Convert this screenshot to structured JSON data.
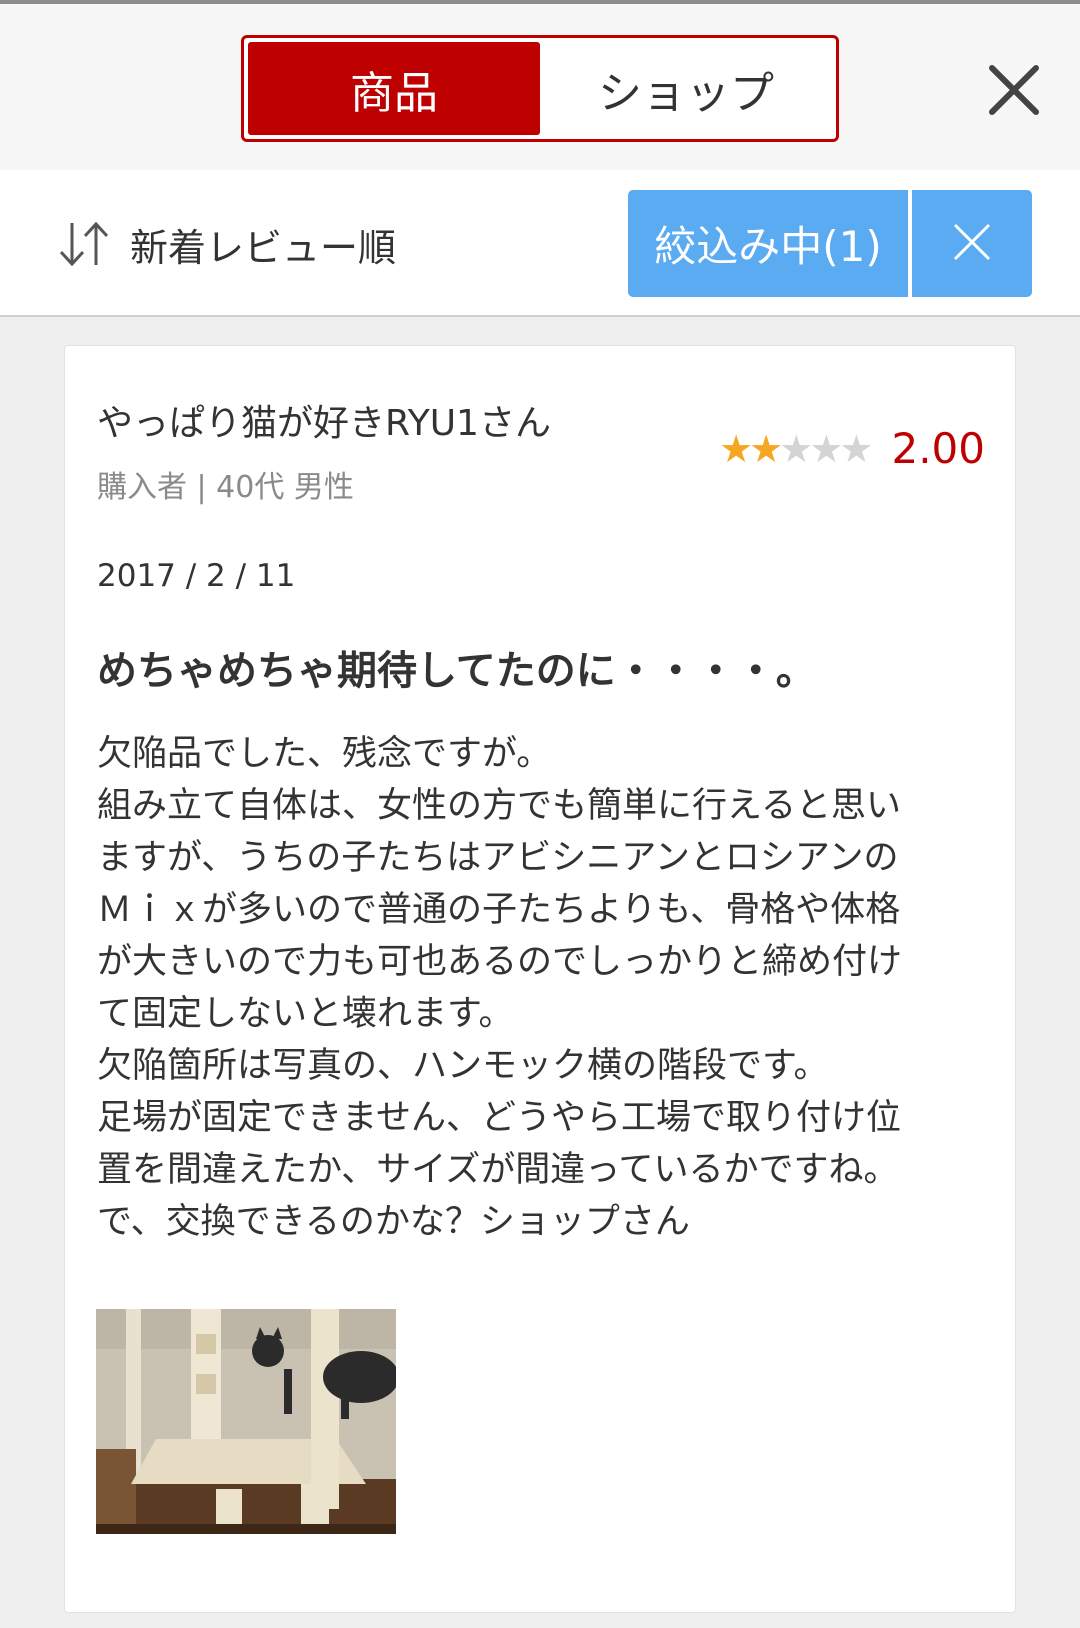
{
  "tabs": {
    "product_label": "商品",
    "shop_label": "ショップ"
  },
  "sort": {
    "label": "新着レビュー順"
  },
  "filter": {
    "label": "絞込み中(1)"
  },
  "review": {
    "reviewer": "やっぱり猫が好きRYU1さん",
    "meta": "購入者 | 40代 男性",
    "rating": 2,
    "rating_max": 5,
    "rating_text": "2.00",
    "date": "2017 / 2 / 11",
    "title": "めちゃめちゃ期待してたのに・・・・。",
    "body_lines": [
      "欠陥品でした、残念ですが。",
      "組み立て自体は、女性の方でも簡単に行えると思い",
      "ますが、うちの子たちはアビシニアンとロシアンの",
      "Ｍｉｘが多いので普通の子たちよりも、骨格や体格",
      "が大きいので力も可也あるのでしっかりと締め付け",
      "て固定しないと壊れます。",
      "欠陥箇所は写真の、ハンモック横の階段です。",
      "足場が固定できません、どうやら工場で取り付け位",
      "置を間違えたか、サイズが間違っているかですね。",
      "で、交換できるのかな？ショップさん"
    ]
  },
  "colors": {
    "brand_red": "#bf0000",
    "filter_blue": "#5aabf2",
    "star_on": "#f5a623",
    "star_off": "#d4d4d4"
  },
  "icons": {
    "close": "close-icon",
    "sort": "sort-icon",
    "clear_filter": "clear-filter-icon"
  }
}
